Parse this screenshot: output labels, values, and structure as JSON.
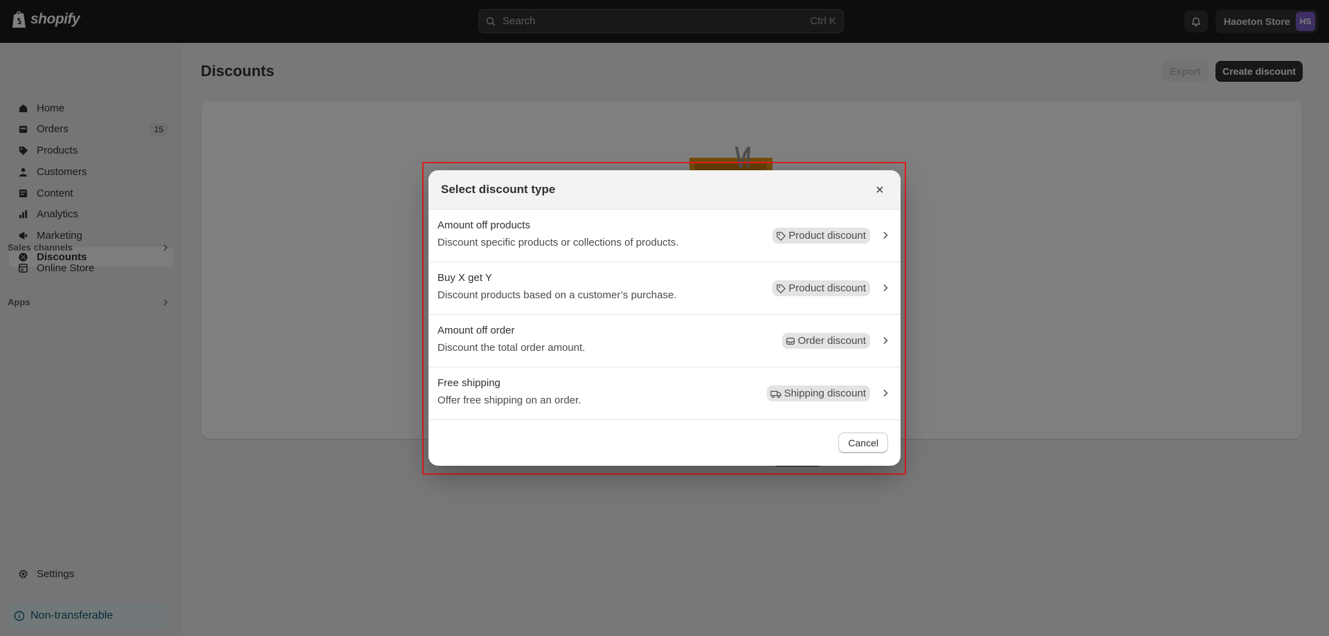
{
  "header": {
    "logo_text": "shopify",
    "search_placeholder": "Search",
    "search_shortcut": "Ctrl K",
    "store_name": "Haoeton Store",
    "store_initials": "HS"
  },
  "sidebar": {
    "items": [
      {
        "label": "Home",
        "icon": "home-icon"
      },
      {
        "label": "Orders",
        "icon": "orders-icon",
        "badge": "15"
      },
      {
        "label": "Products",
        "icon": "tag-icon"
      },
      {
        "label": "Customers",
        "icon": "person-icon"
      },
      {
        "label": "Content",
        "icon": "content-icon"
      },
      {
        "label": "Analytics",
        "icon": "analytics-icon"
      },
      {
        "label": "Marketing",
        "icon": "marketing-icon"
      },
      {
        "label": "Discounts",
        "icon": "discount-icon",
        "active": true
      }
    ],
    "sales_channels_label": "Sales channels",
    "online_store_label": "Online Store",
    "apps_label": "Apps",
    "settings_label": "Settings",
    "nontransferable_label": "Non-transferable"
  },
  "main": {
    "title": "Discounts",
    "export_label": "Export",
    "create_label": "Create discount"
  },
  "modal": {
    "title": "Select discount type",
    "options": [
      {
        "title": "Amount off products",
        "description": "Discount specific products or collections of products.",
        "tag": "Product discount"
      },
      {
        "title": "Buy X get Y",
        "description": "Discount products based on a customer’s purchase.",
        "tag": "Product discount"
      },
      {
        "title": "Amount off order",
        "description": "Discount the total order amount.",
        "tag": "Order discount"
      },
      {
        "title": "Free shipping",
        "description": "Offer free shipping on an order.",
        "tag": "Shipping discount"
      }
    ],
    "cancel_label": "Cancel"
  }
}
